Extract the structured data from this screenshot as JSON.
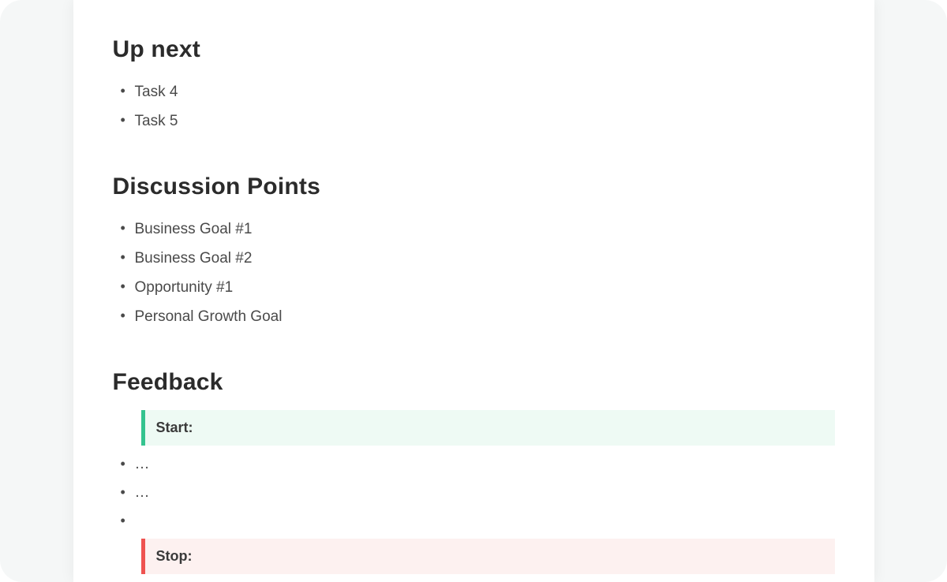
{
  "sections": {
    "up_next": {
      "heading": "Up next",
      "items": [
        "Task 4",
        "Task 5"
      ]
    },
    "discussion": {
      "heading": "Discussion Points",
      "items": [
        "Business Goal #1",
        "Business Goal #2",
        "Opportunity #1",
        "Personal Growth Goal"
      ]
    },
    "feedback": {
      "heading": "Feedback",
      "start_label": "Start:",
      "start_items": [
        "…",
        "…",
        ""
      ],
      "stop_label": "Stop:"
    }
  },
  "colors": {
    "start_accent": "#34c38f",
    "start_bg": "#eefaf4",
    "stop_accent": "#ef5350",
    "stop_bg": "#fdf1f0"
  }
}
